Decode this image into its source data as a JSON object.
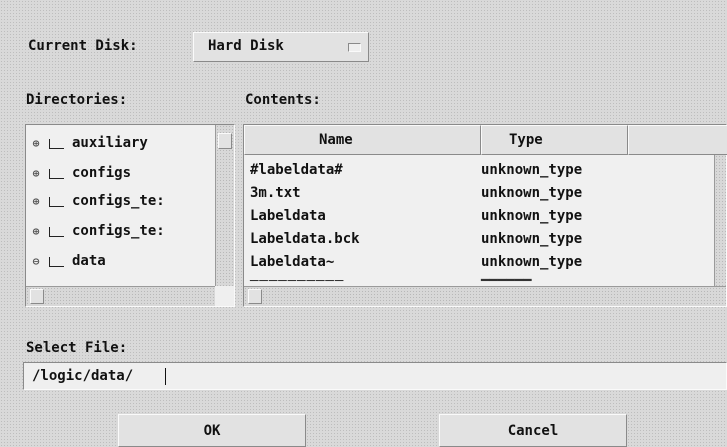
{
  "current_disk": {
    "label": "Current Disk:",
    "value": "Hard Disk"
  },
  "directories": {
    "label": "Directories:",
    "items": [
      {
        "name": "auxiliary"
      },
      {
        "name": "configs"
      },
      {
        "name": "configs_te:"
      },
      {
        "name": "configs_te:"
      },
      {
        "name": "data"
      }
    ]
  },
  "contents": {
    "label": "Contents:",
    "columns": {
      "name": "Name",
      "type": "Type"
    },
    "rows": [
      {
        "name": "#labeldata#",
        "type": "unknown_type"
      },
      {
        "name": "3m.txt",
        "type": "unknown_type"
      },
      {
        "name": "Labeldata",
        "type": "unknown_type"
      },
      {
        "name": "Labeldata.bck",
        "type": "unknown_type"
      },
      {
        "name": "Labeldata~",
        "type": "unknown_type"
      }
    ]
  },
  "select_file": {
    "label": "Select File:",
    "value": "/logic/data/"
  },
  "buttons": {
    "ok": "OK",
    "cancel": "Cancel"
  }
}
